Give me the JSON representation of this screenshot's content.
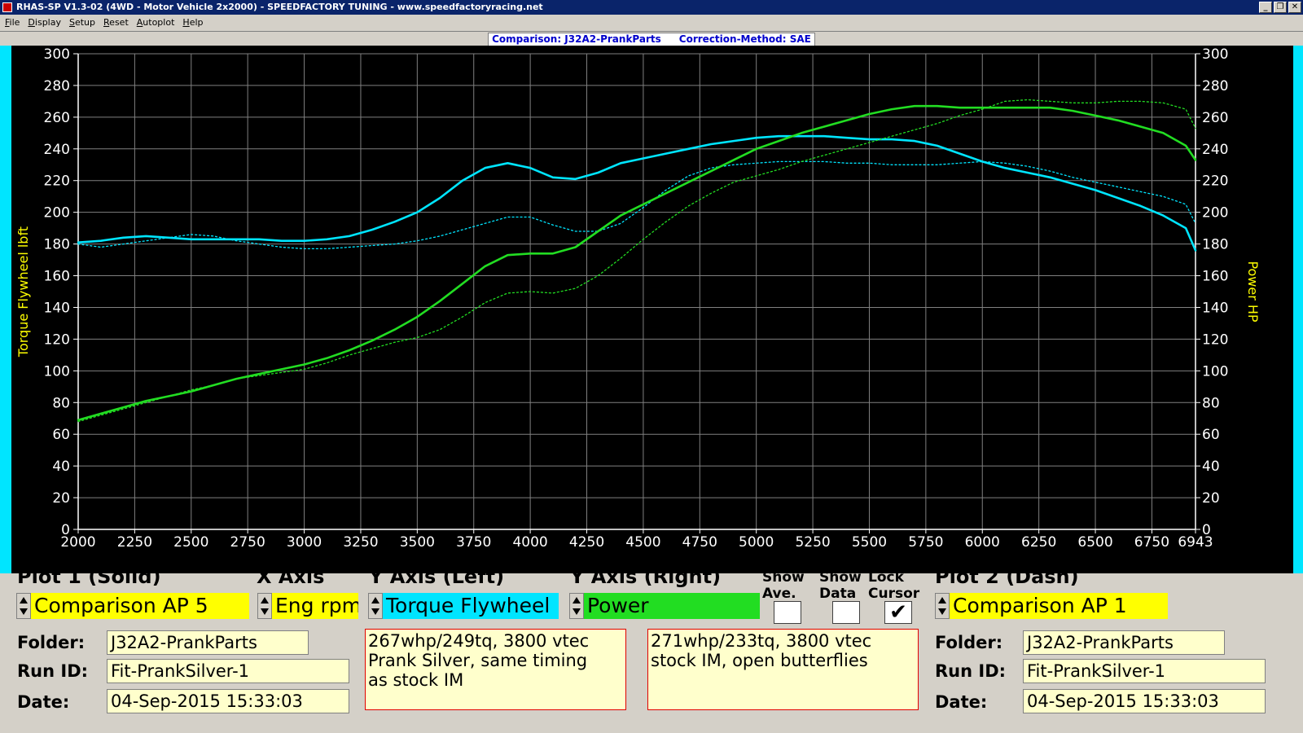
{
  "window": {
    "title": "RHAS-SP V1.3-02  (4WD - Motor Vehicle 2x2000) - SPEEDFACTORY TUNING - www.speedfactoryracing.net",
    "controls": [
      "_",
      "❐",
      "✕"
    ]
  },
  "menu": [
    "File",
    "Display",
    "Setup",
    "Reset",
    "Autoplot",
    "Help"
  ],
  "info": {
    "comparison": "Comparison: J32A2-PrankParts",
    "correction": "Correction-Method: SAE"
  },
  "chart_data": {
    "type": "line",
    "xlabel": "",
    "ylabel_left": "Torque Flywheel lbft",
    "ylabel_right": "Power HP",
    "xlim": [
      2000,
      6943
    ],
    "ylim": [
      0,
      300
    ],
    "x_ticks": [
      "2000",
      "2250",
      "2500",
      "2750",
      "3000",
      "3250",
      "3500",
      "3750",
      "4000",
      "4250",
      "4500",
      "4750",
      "5000",
      "5250",
      "5500",
      "5750",
      "6000",
      "6250",
      "6500",
      "6750",
      "6943"
    ],
    "y_ticks": [
      "0",
      "20",
      "40",
      "60",
      "80",
      "100",
      "120",
      "140",
      "160",
      "180",
      "200",
      "220",
      "240",
      "260",
      "280",
      "300"
    ],
    "grid": true,
    "colors": {
      "background": "#000000",
      "grid": "#808080",
      "axis": "#ffffff",
      "torque": "#00e5ff",
      "power": "#22dd22",
      "axis_title": "#ffff00"
    },
    "series": [
      {
        "name": "Torque Flywheel",
        "plot": "Plot 1 (Solid)",
        "style": "solid",
        "color": "#00e5ff",
        "x": [
          2000,
          2100,
          2200,
          2300,
          2400,
          2500,
          2600,
          2700,
          2800,
          2900,
          3000,
          3100,
          3200,
          3300,
          3400,
          3500,
          3600,
          3700,
          3800,
          3900,
          4000,
          4100,
          4200,
          4300,
          4400,
          4500,
          4600,
          4700,
          4800,
          4900,
          5000,
          5100,
          5200,
          5300,
          5400,
          5500,
          5600,
          5700,
          5800,
          5900,
          6000,
          6100,
          6200,
          6300,
          6400,
          6500,
          6600,
          6700,
          6800,
          6900,
          6943
        ],
        "y": [
          181,
          182,
          184,
          185,
          184,
          183,
          183,
          183,
          183,
          182,
          182,
          183,
          185,
          189,
          194,
          200,
          209,
          220,
          228,
          231,
          228,
          222,
          221,
          225,
          231,
          234,
          237,
          240,
          243,
          245,
          247,
          248,
          248,
          248,
          247,
          246,
          246,
          245,
          242,
          237,
          232,
          228,
          225,
          222,
          218,
          214,
          209,
          204,
          198,
          190,
          176
        ]
      },
      {
        "name": "Torque Flywheel",
        "plot": "Plot 2 (Dash)",
        "style": "dash",
        "color": "#00e5ff",
        "x": [
          2000,
          2100,
          2200,
          2300,
          2400,
          2500,
          2600,
          2700,
          2800,
          2900,
          3000,
          3100,
          3200,
          3300,
          3400,
          3500,
          3600,
          3700,
          3800,
          3900,
          4000,
          4100,
          4200,
          4300,
          4400,
          4500,
          4600,
          4700,
          4800,
          4900,
          5000,
          5100,
          5200,
          5300,
          5400,
          5500,
          5600,
          5700,
          5800,
          5900,
          6000,
          6100,
          6200,
          6300,
          6400,
          6500,
          6600,
          6700,
          6800,
          6900,
          6943
        ],
        "y": [
          180,
          178,
          180,
          182,
          184,
          186,
          185,
          182,
          180,
          178,
          177,
          177,
          178,
          179,
          180,
          182,
          185,
          189,
          193,
          197,
          197,
          192,
          188,
          188,
          193,
          203,
          214,
          223,
          228,
          230,
          231,
          232,
          232,
          232,
          231,
          231,
          230,
          230,
          230,
          231,
          232,
          231,
          229,
          226,
          222,
          219,
          216,
          213,
          210,
          205,
          193
        ]
      },
      {
        "name": "Power",
        "plot": "Plot 1 (Solid)",
        "style": "solid",
        "color": "#22dd22",
        "x": [
          2000,
          2100,
          2200,
          2300,
          2400,
          2500,
          2600,
          2700,
          2800,
          2900,
          3000,
          3100,
          3200,
          3300,
          3400,
          3500,
          3600,
          3700,
          3800,
          3900,
          4000,
          4100,
          4200,
          4300,
          4400,
          4500,
          4600,
          4700,
          4800,
          4900,
          5000,
          5100,
          5200,
          5300,
          5400,
          5500,
          5600,
          5700,
          5800,
          5900,
          6000,
          6100,
          6200,
          6300,
          6400,
          6500,
          6600,
          6700,
          6800,
          6900,
          6943
        ],
        "y": [
          69,
          73,
          77,
          81,
          84,
          87,
          91,
          95,
          98,
          101,
          104,
          108,
          113,
          119,
          126,
          134,
          144,
          155,
          166,
          173,
          174,
          174,
          178,
          188,
          198,
          205,
          212,
          219,
          226,
          233,
          240,
          245,
          250,
          254,
          258,
          262,
          265,
          267,
          267,
          266,
          266,
          266,
          266,
          266,
          264,
          261,
          258,
          254,
          250,
          242,
          233
        ]
      },
      {
        "name": "Power",
        "plot": "Plot 2 (Dash)",
        "style": "dash",
        "color": "#22dd22",
        "x": [
          2000,
          2100,
          2200,
          2300,
          2400,
          2500,
          2600,
          2700,
          2800,
          2900,
          3000,
          3100,
          3200,
          3300,
          3400,
          3500,
          3600,
          3700,
          3800,
          3900,
          4000,
          4100,
          4200,
          4300,
          4400,
          4500,
          4600,
          4700,
          4800,
          4900,
          5000,
          5100,
          5200,
          5300,
          5400,
          5500,
          5600,
          5700,
          5800,
          5900,
          6000,
          6100,
          6200,
          6300,
          6400,
          6500,
          6600,
          6700,
          6800,
          6900,
          6943
        ],
        "y": [
          68,
          72,
          76,
          80,
          84,
          88,
          91,
          95,
          97,
          99,
          101,
          105,
          110,
          114,
          118,
          121,
          126,
          134,
          143,
          149,
          150,
          149,
          152,
          160,
          171,
          183,
          194,
          204,
          212,
          219,
          223,
          227,
          232,
          236,
          240,
          244,
          248,
          252,
          256,
          261,
          265,
          270,
          271,
          270,
          269,
          269,
          270,
          270,
          269,
          265,
          253
        ]
      }
    ]
  },
  "controls": {
    "plot1": {
      "title": "Plot 1 (Solid)",
      "value": "Comparison AP 5",
      "color": "#ffff00"
    },
    "xaxis": {
      "title": "X Axis",
      "value": "Eng rpm",
      "color": "#ffff00"
    },
    "yleft": {
      "title": "Y Axis (Left)",
      "value": "Torque Flywheel",
      "color": "#00e5ff"
    },
    "yright": {
      "title": "Y Axis (Right)",
      "value": "Power",
      "color": "#22dd22"
    },
    "show_ave": {
      "line1": "Show",
      "line2": "Ave.",
      "checked": false
    },
    "show_data": {
      "line1": "Show",
      "line2": "Data",
      "checked": false
    },
    "lock_cursor": {
      "line1": "Lock",
      "line2": "Cursor",
      "checked": true,
      "mark": "✔"
    },
    "plot2": {
      "title": "Plot 2 (Dash)",
      "value": "Comparison AP 1",
      "color": "#ffff00"
    }
  },
  "run1": {
    "folder_label": "Folder:",
    "folder": "J32A2-PrankParts",
    "runid_label": "Run ID:",
    "runid": "Fit-PrankSilver-1",
    "date_label": "Date:",
    "date": "04-Sep-2015   15:33:03",
    "note": "267whp/249tq, 3800 vtec\nPrank Silver, same timing\nas stock IM"
  },
  "run2": {
    "folder_label": "Folder:",
    "folder": "J32A2-PrankParts",
    "runid_label": "Run ID:",
    "runid": "Fit-PrankSilver-1",
    "date_label": "Date:",
    "date": "04-Sep-2015   15:33:03",
    "note": "271whp/233tq, 3800 vtec\nstock IM, open butterflies"
  }
}
